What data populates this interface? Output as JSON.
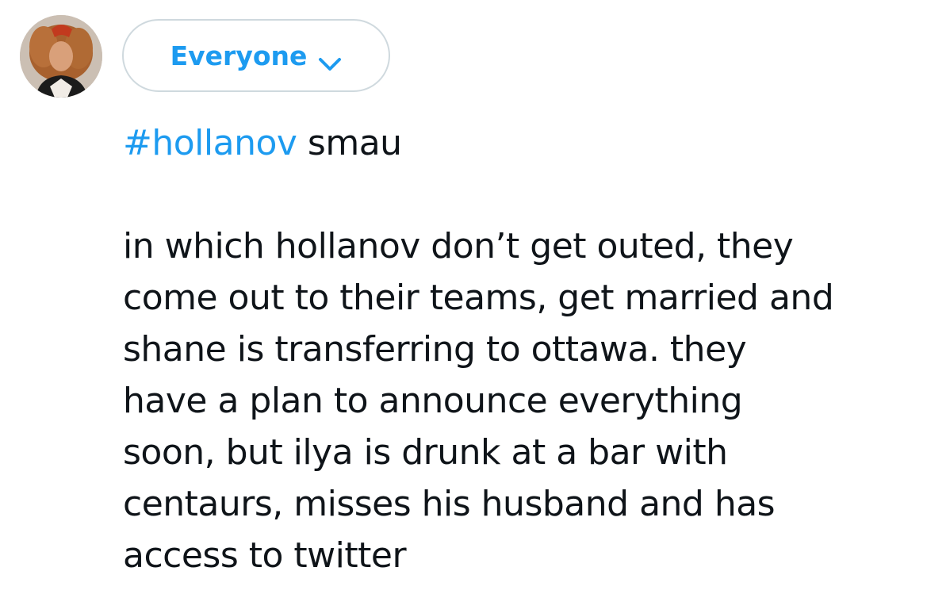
{
  "composer": {
    "avatar_icon": "user-avatar",
    "audience": {
      "label": "Everyone",
      "icon": "chevron-down-icon",
      "accent_color": "#1d9bf0"
    }
  },
  "tweet": {
    "hashtag": "#hollanov",
    "first_line_rest": " smau",
    "body_lines": [
      "in which hollanov don’t get outed, they",
      "come out to their teams, get married and",
      "shane is transferring to ottawa. they",
      "have a plan to announce everything",
      "soon, but ilya is drunk at a bar with",
      "centaurs, misses his husband and has",
      "access to twitter"
    ]
  }
}
